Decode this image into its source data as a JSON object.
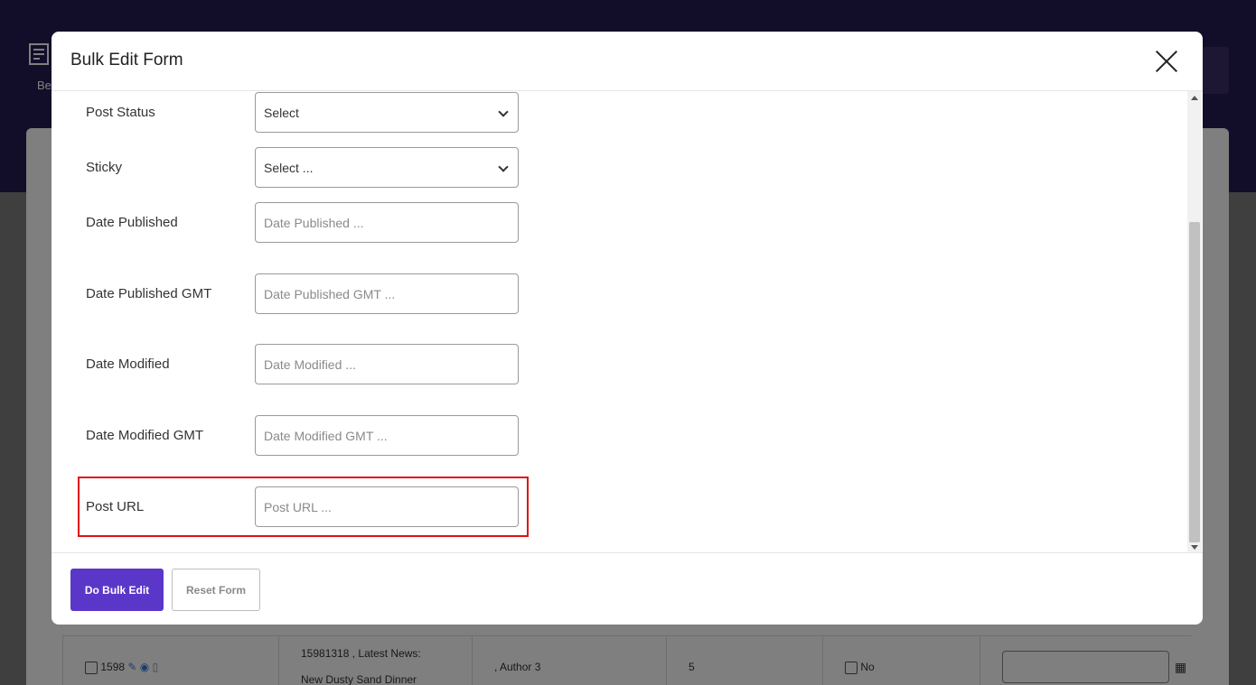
{
  "background": {
    "logo_text": "Be",
    "row": {
      "id": "1598",
      "title_line1": "15981318 , Latest News:",
      "title_line2": "New Dusty Sand Dinner",
      "author": ", Author 3",
      "count": "5",
      "sticky": "No"
    }
  },
  "modal": {
    "title": "Bulk Edit Form",
    "fields": {
      "post_status": {
        "label": "Post Status",
        "value": "Select"
      },
      "sticky": {
        "label": "Sticky",
        "value": "Select ..."
      },
      "date_published": {
        "label": "Date Published",
        "placeholder": "Date Published ..."
      },
      "date_published_gmt": {
        "label": "Date Published GMT",
        "placeholder": "Date Published GMT ..."
      },
      "date_modified": {
        "label": "Date Modified",
        "placeholder": "Date Modified ..."
      },
      "date_modified_gmt": {
        "label": "Date Modified GMT",
        "placeholder": "Date Modified GMT ..."
      },
      "post_url": {
        "label": "Post URL",
        "placeholder": "Post URL ..."
      }
    },
    "footer": {
      "primary_label": "Do Bulk Edit",
      "secondary_label": "Reset Form"
    }
  },
  "colors": {
    "header_bg": "#251a52",
    "primary_button": "#5b37c9",
    "highlight": "#e01010"
  }
}
